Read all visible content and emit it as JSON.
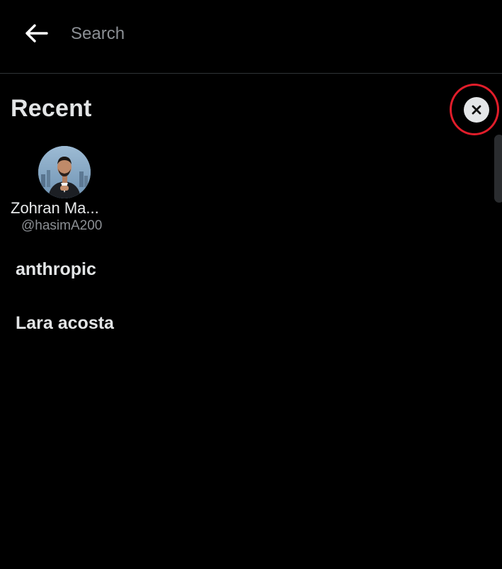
{
  "header": {
    "back_icon": "arrow-left-icon",
    "search_placeholder": "Search"
  },
  "recent": {
    "title": "Recent",
    "clear_icon": "close-icon",
    "users": [
      {
        "name": "Zohran Ma...",
        "handle": "@hasimA200"
      }
    ],
    "queries": [
      "anthropic",
      "Lara acosta"
    ]
  },
  "colors": {
    "background": "#000000",
    "text": "#e7e9ea",
    "muted": "#8b8f94",
    "highlight": "#e11d2a"
  }
}
